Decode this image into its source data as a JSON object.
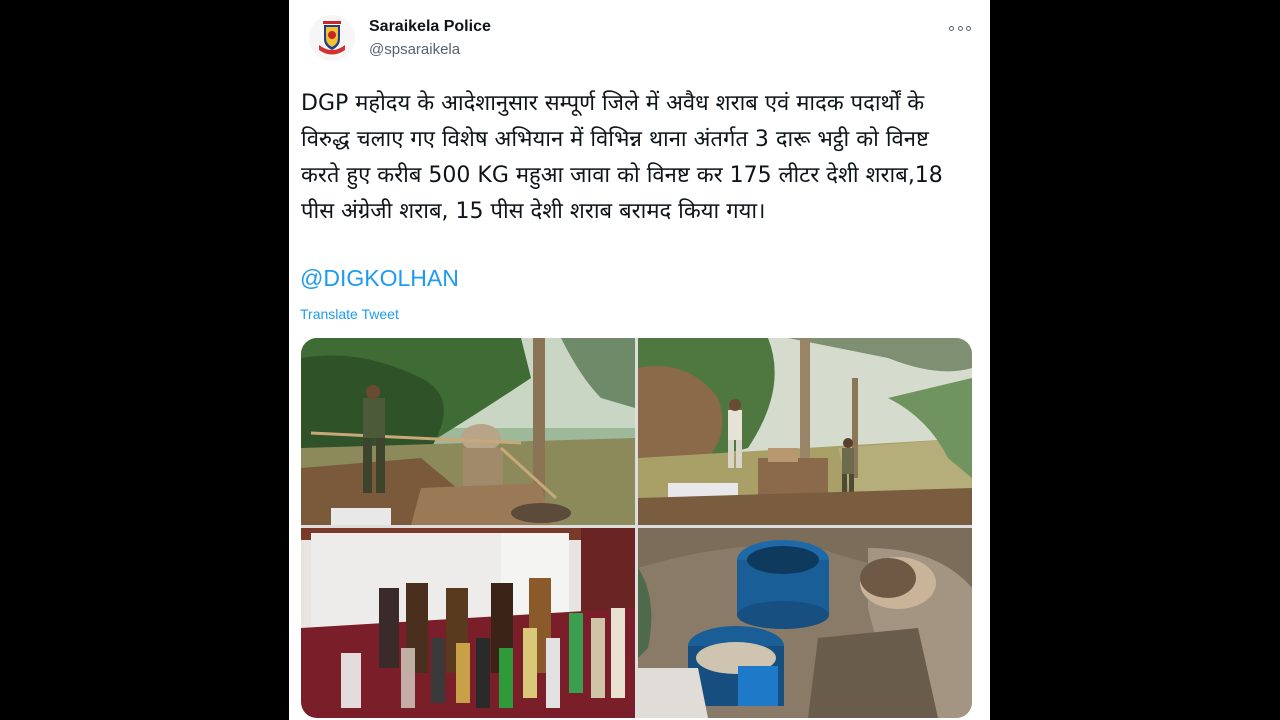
{
  "tweet": {
    "display_name": "Saraikela Police",
    "handle": "@spsaraikela",
    "text": "DGP महोदय के आदेशानुसार सम्पूर्ण जिले में अवैध शराब एवं मादक पदार्थों के विरुद्ध चलाए गए विशेष अभियान में विभिन्न थाना अंतर्गत 3 दारू भट्ठी को विनष्ट करते हुए करीब 500 KG महुआ जावा को विनष्ट कर 175 लीटर देशी शराब,18 पीस अंग्रेजी शराब, 15 पीस देशी शराब बरामद किया गया।",
    "mention": "@DIGKOLHAN",
    "translate_label": "Translate Tweet"
  },
  "colors": {
    "link": "#1d9bf0",
    "text": "#0f1419",
    "muted": "#536471",
    "background": "#000000",
    "card": "#ffffff"
  },
  "icons": {
    "more": "more-horizontal-icon",
    "avatar": "police-emblem-icon"
  }
}
